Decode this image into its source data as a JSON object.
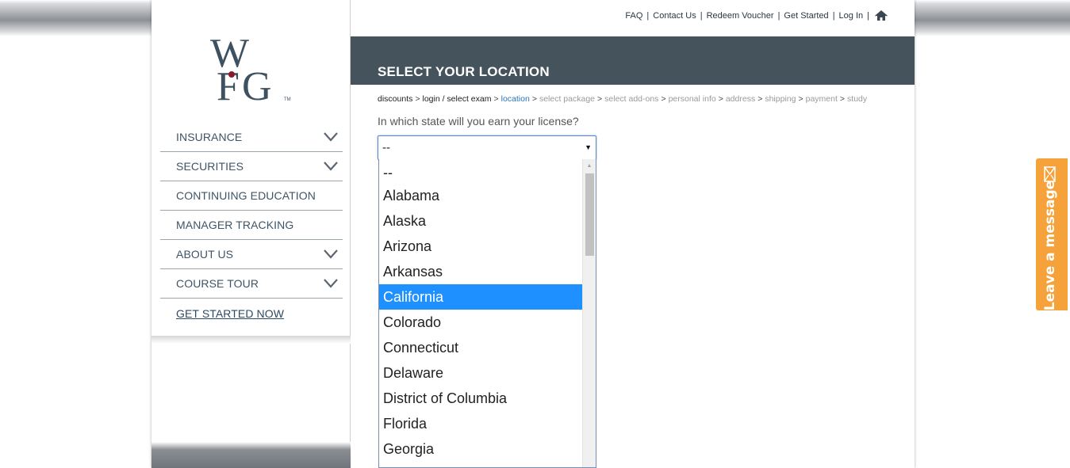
{
  "top_links": {
    "faq": "FAQ",
    "contact": "Contact Us",
    "redeem": "Redeem Voucher",
    "started": "Get Started",
    "login": "Log In",
    "separator": "|",
    "home_icon": "home-icon"
  },
  "logo": {
    "text_w": "W",
    "text_f": "F",
    "text_g": "G",
    "tm": "TM"
  },
  "sidebar": {
    "items": [
      {
        "label": "INSURANCE",
        "has_chevron": true
      },
      {
        "label": "SECURITIES",
        "has_chevron": true
      },
      {
        "label": "CONTINUING EDUCATION",
        "has_chevron": false
      },
      {
        "label": "MANAGER TRACKING",
        "has_chevron": false
      },
      {
        "label": "ABOUT US",
        "has_chevron": true
      },
      {
        "label": "COURSE TOUR",
        "has_chevron": true
      },
      {
        "label": "GET STARTED NOW",
        "has_chevron": false
      }
    ]
  },
  "header": {
    "title": "SELECT YOUR LOCATION"
  },
  "breadcrumb": {
    "steps": [
      {
        "label": "discounts",
        "state": "done"
      },
      {
        "label": "login / select exam",
        "state": "done"
      },
      {
        "label": "location",
        "state": "current"
      },
      {
        "label": "select package",
        "state": "todo"
      },
      {
        "label": "select add-ons",
        "state": "todo"
      },
      {
        "label": "personal info",
        "state": "todo"
      },
      {
        "label": "address",
        "state": "todo"
      },
      {
        "label": "shipping",
        "state": "todo"
      },
      {
        "label": "payment",
        "state": "todo"
      },
      {
        "label": "study",
        "state": "todo"
      }
    ],
    "separator": ">"
  },
  "form": {
    "question": "In which state will you earn your license?",
    "selected_value": "--",
    "arrow": "▼",
    "options": [
      "--",
      "Alabama",
      "Alaska",
      "Arizona",
      "Arkansas",
      "California",
      "Colorado",
      "Connecticut",
      "Delaware",
      "District of Columbia",
      "Florida",
      "Georgia"
    ],
    "highlighted_option": "California"
  },
  "leave_message": {
    "label": "Leave a message",
    "icon": "mail-icon"
  },
  "colors": {
    "header_bar": "#45535c",
    "nav_text": "#3f5467",
    "breadcrumb_current": "#2b77b5",
    "highlight": "#1e90ff",
    "leave_tab": "#f6a23b",
    "logo_dot": "#8b1a2b",
    "logo_letters": "#3e5160"
  }
}
